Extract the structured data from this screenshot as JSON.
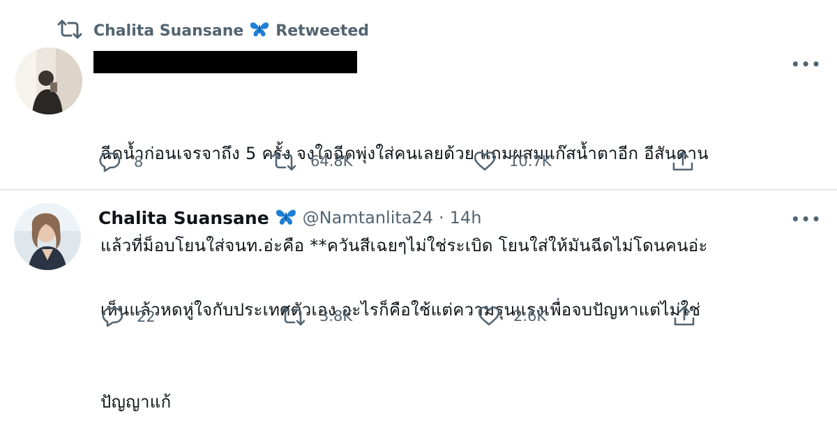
{
  "retweet_banner": {
    "user_name": "Chalita Suansane",
    "label": "Retweeted"
  },
  "tweet1": {
    "text_line1": "ฉีดน้ำก่อนเจรจาถึง 5 ครั้ง จงใจฉีดพุ่งใส่คนเลยด้วย แถมผสมแก๊สน้ำตาอีก อีสันดาน",
    "text_line2": "แล้วที่ม็อบโยนใส่จนท.อ่ะคือ **ควันสีเฉยๆไม่ใช่ระเบิด โยนใส่ให้มันฉีดไม่โดนคนอ่ะ",
    "more": "•••",
    "replies": "8",
    "retweets": "64.8K",
    "likes": "10.7K"
  },
  "tweet2": {
    "name": "Chalita Suansane",
    "handle": "@Namtanlita24",
    "separator": "·",
    "time": "14h",
    "text_line1": "เห็นแล้วหดหู่ใจกับประเทศตัวเอง อะไรก็คือใช้แต่ความรุนแรงเพื่อจบปัญหาแต่ไม่ใช่",
    "text_line2": "ปัญญาแก้",
    "more": "•••",
    "replies": "22",
    "retweets": "3.8K",
    "likes": "2.6K"
  },
  "colors": {
    "muted": "#536471",
    "text": "#0f1419",
    "divider": "#e6ecf0",
    "butterfly": "#1d7fd6"
  },
  "icons": [
    "retweet-icon",
    "butterfly-icon",
    "reply-icon",
    "like-icon",
    "share-icon",
    "more-icon"
  ]
}
